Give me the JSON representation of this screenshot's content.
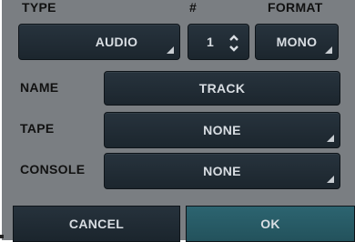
{
  "labels": {
    "type": "TYPE",
    "count": "#",
    "format": "FORMAT",
    "name": "NAME",
    "tape": "TAPE",
    "console": "CONSOLE"
  },
  "fields": {
    "type_value": "AUDIO",
    "count_value": "1",
    "format_value": "MONO",
    "name_value": "TRACK",
    "tape_value": "NONE",
    "console_value": "NONE"
  },
  "buttons": {
    "cancel": "CANCEL",
    "ok": "OK"
  },
  "colors": {
    "panel": "#7a7e82",
    "control": "#1f2a33",
    "ok_button": "#285a66",
    "text": "#d8dde2"
  }
}
